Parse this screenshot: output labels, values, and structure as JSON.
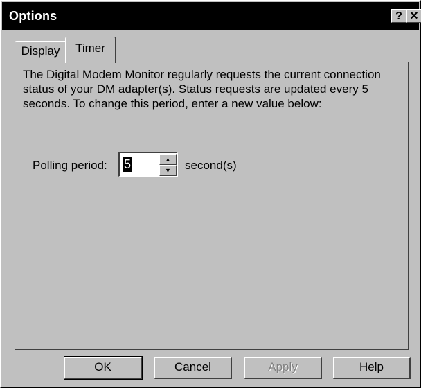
{
  "window": {
    "title": "Options",
    "help_button": "?",
    "close_button": "✕"
  },
  "tabs": [
    {
      "label": "Display",
      "active": false
    },
    {
      "label": "Timer",
      "active": true
    }
  ],
  "timer_panel": {
    "description": "The Digital Modem Monitor regularly requests the current connection status of your DM adapter(s). Status requests are updated every 5 seconds. To change this period, enter a new value below:",
    "polling_label_mnemonic": "P",
    "polling_label_rest": "olling period:",
    "polling_value": "5",
    "unit": "second(s)"
  },
  "buttons": {
    "ok": "OK",
    "cancel": "Cancel",
    "apply": "Apply",
    "help": "Help"
  }
}
